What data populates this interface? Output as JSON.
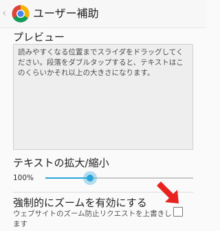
{
  "app_bar": {
    "back_glyph": "‹",
    "title": "ユーザー補助",
    "logo_icon": "chrome-logo-icon"
  },
  "preview": {
    "heading": "プレビュー",
    "text": "読みやすくなる位置までスライダをドラッグしてください。段落をダブルタップすると、テキストはこのくらいかそれ以上の大きさになります。"
  },
  "text_scaling": {
    "label": "テキストの拡大/縮小",
    "value": "100%",
    "slider_level": 0.3
  },
  "force_zoom": {
    "title": "強制的にズームを有効にする",
    "description": "ウェブサイトのズーム防止リクエストを上書きします",
    "checked": false
  },
  "colors": {
    "accent": "#2aa5d9",
    "annotation_arrow": "#e8231f",
    "background": "#fafafa"
  }
}
